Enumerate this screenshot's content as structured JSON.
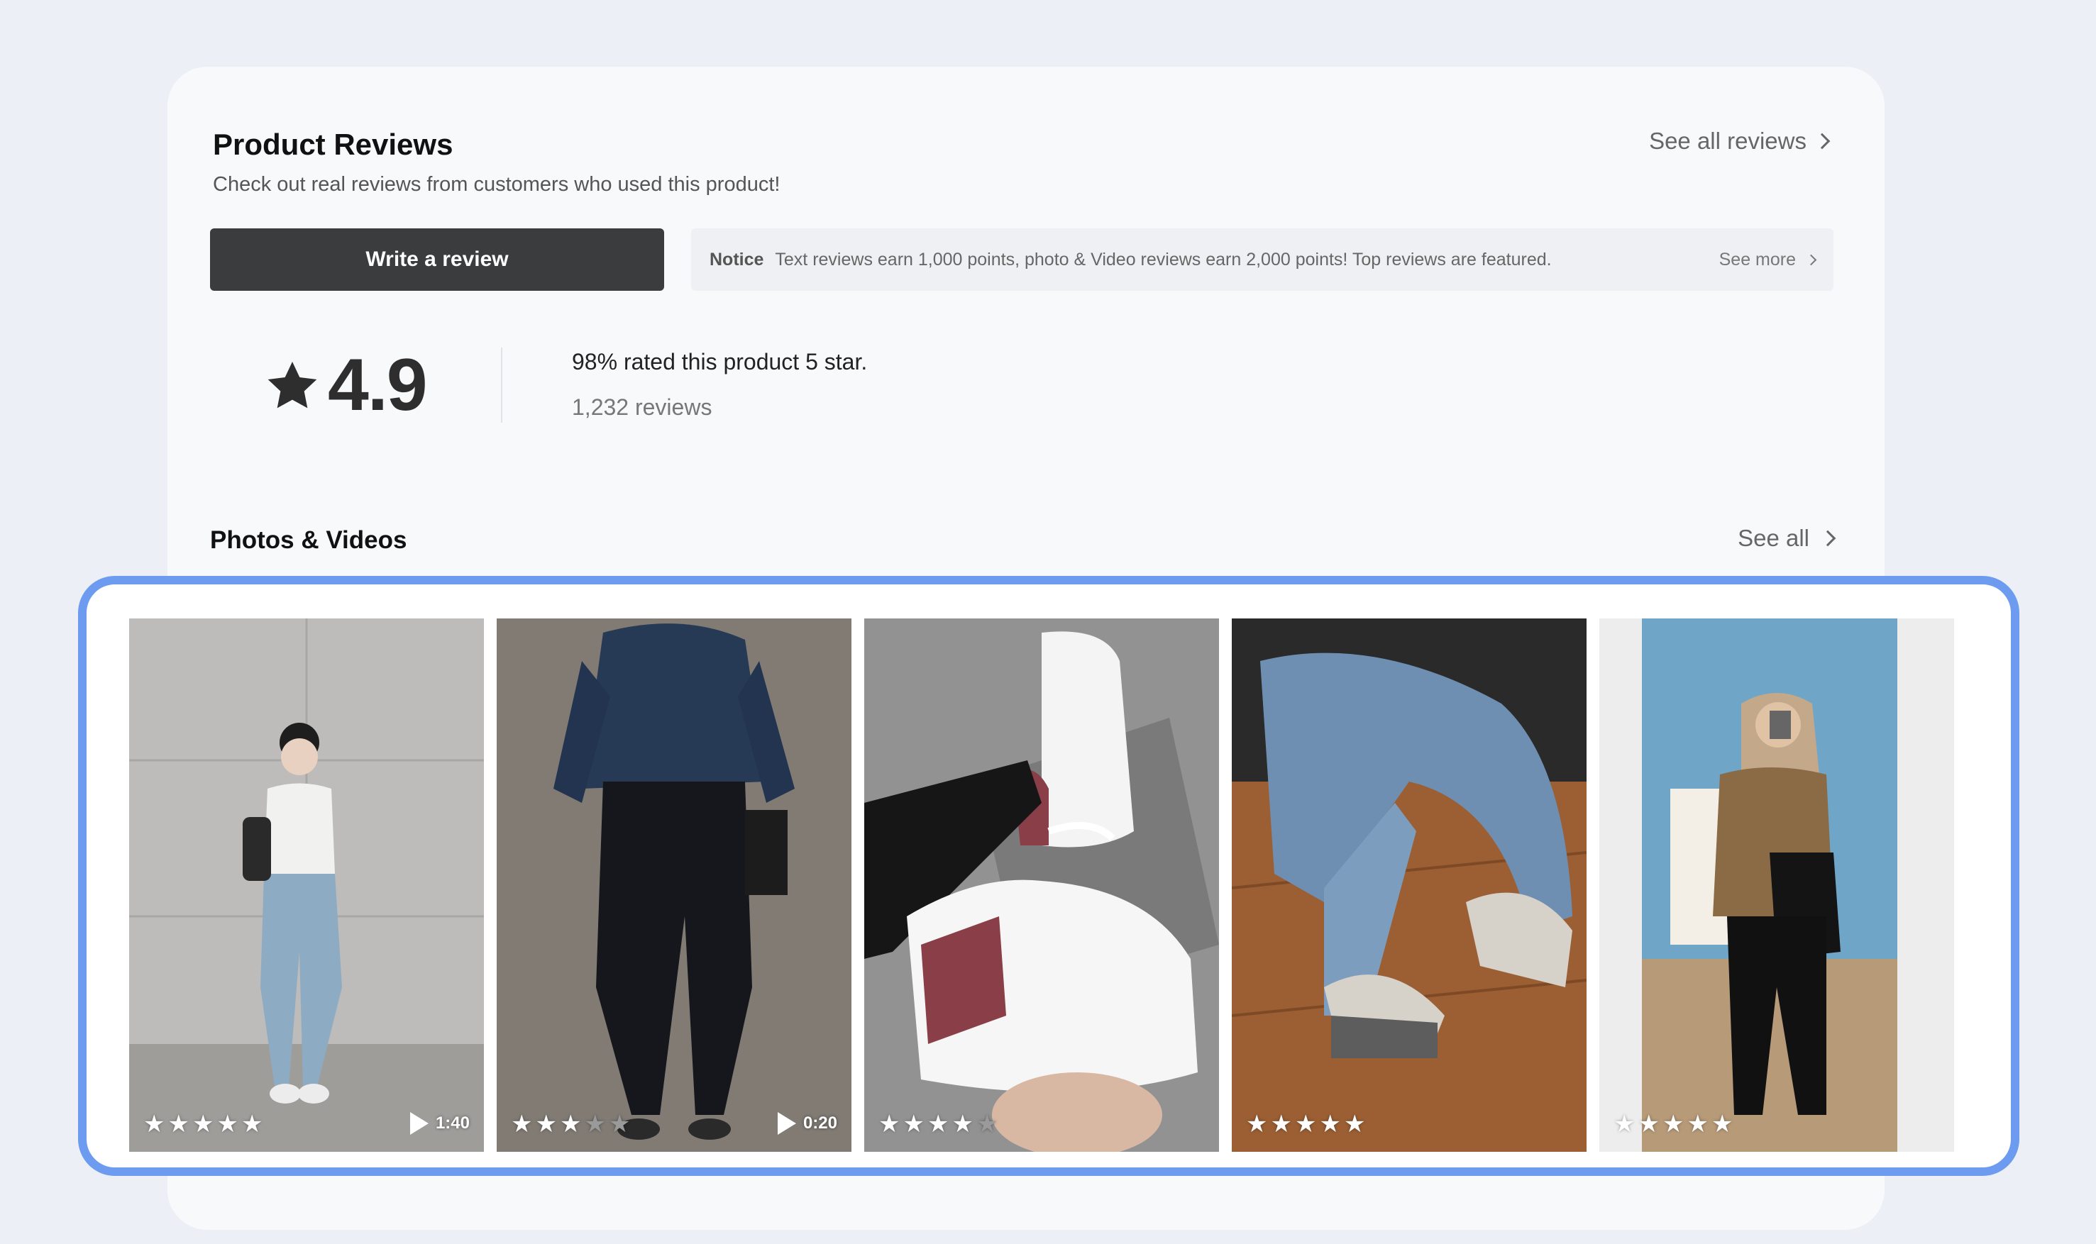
{
  "header": {
    "title": "Product Reviews",
    "subtitle": "Check out real reviews from customers who used this product!",
    "see_all_reviews": "See all reviews"
  },
  "actions": {
    "write_review": "Write a review"
  },
  "notice": {
    "label": "Notice",
    "text": "Text reviews earn 1,000 points, photo & Video reviews earn 2,000 points! Top reviews are featured.",
    "see_more": "See more"
  },
  "summary": {
    "score": "4.9",
    "percent_text": "98% rated this product 5 star.",
    "review_count": "1,232 reviews"
  },
  "media": {
    "title": "Photos & Videos",
    "see_all": "See all",
    "items": [
      {
        "rating": 5,
        "duration": "1:40",
        "is_video": true
      },
      {
        "rating": 3,
        "duration": "0:20",
        "is_video": true
      },
      {
        "rating": 4,
        "duration": "",
        "is_video": false
      },
      {
        "rating": 5,
        "duration": "",
        "is_video": false
      },
      {
        "rating": 5,
        "duration": "",
        "is_video": false
      }
    ]
  },
  "colors": {
    "accent_border": "#6d9bef",
    "button_bg": "#3b3c3e",
    "page_bg": "#ecf0f6",
    "card_bg": "#f8f9fb"
  }
}
